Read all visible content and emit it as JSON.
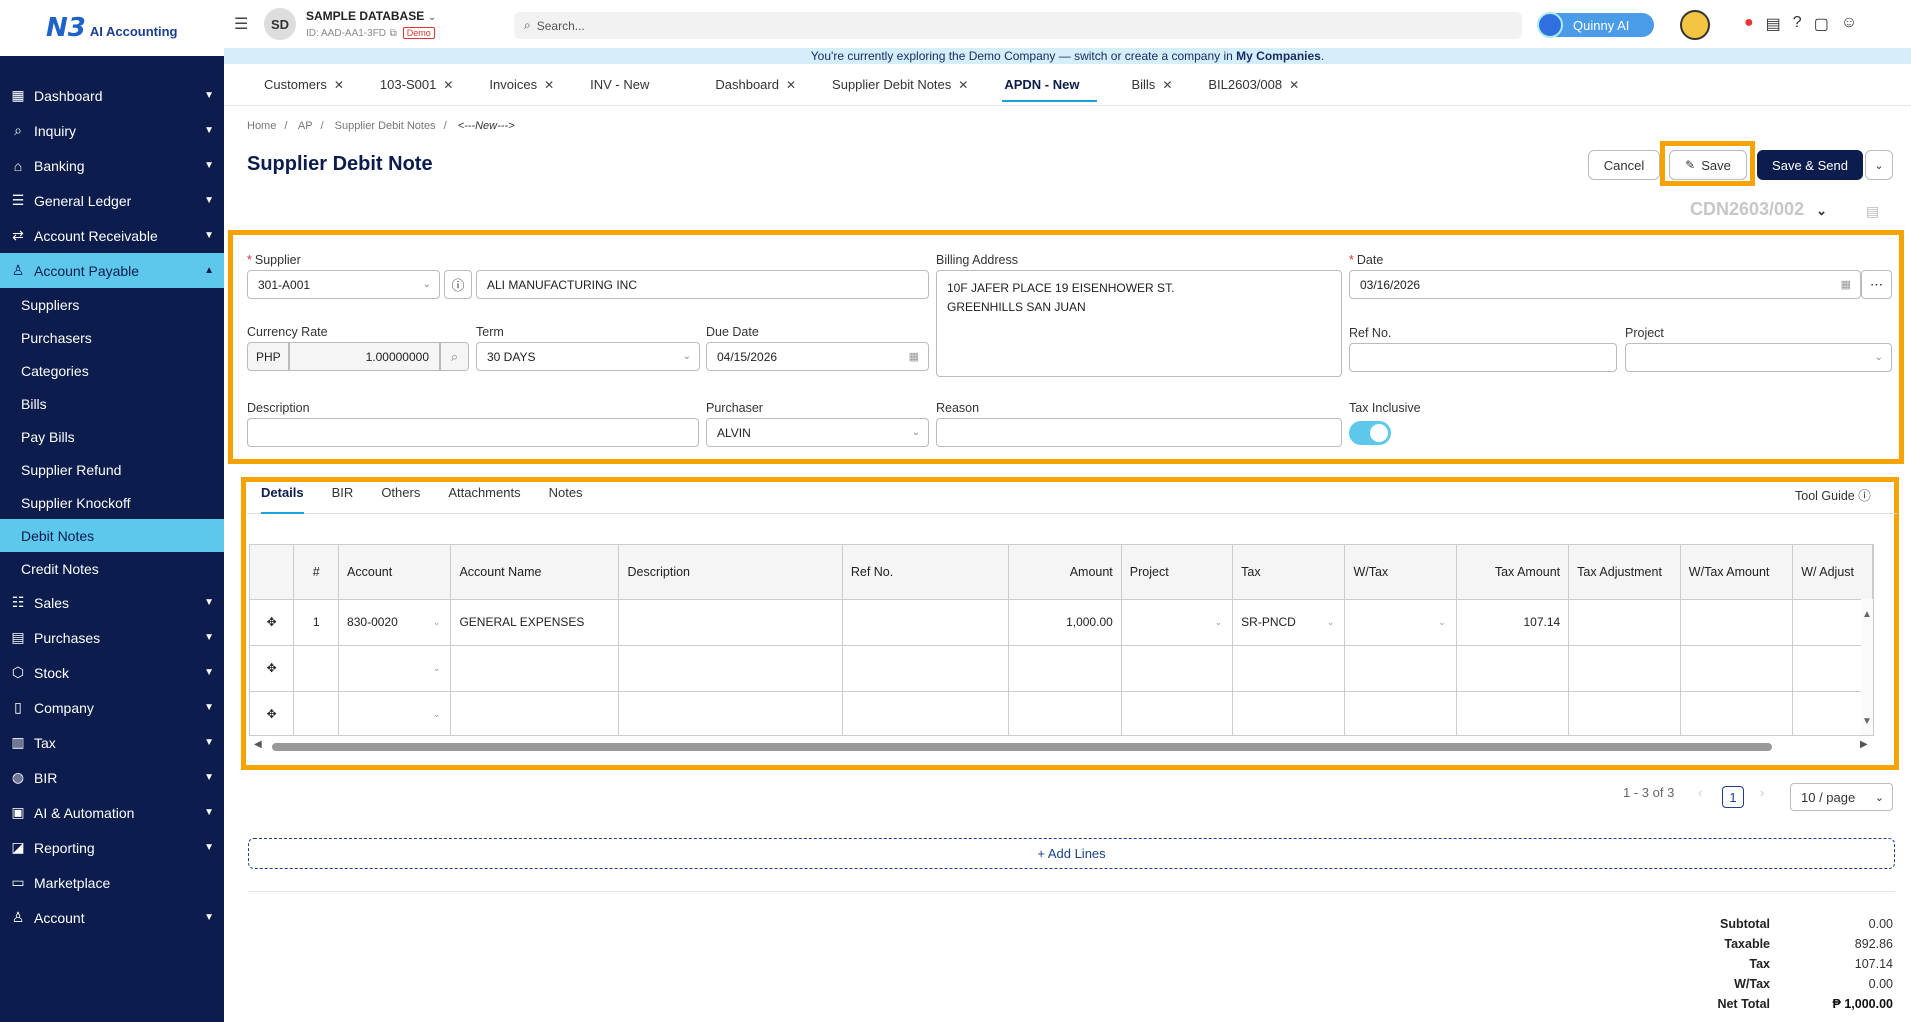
{
  "app": {
    "logo_mark": "N3",
    "logo_text": "AI Accounting"
  },
  "sidebar": {
    "items": [
      {
        "label": "Dashboard",
        "icon": "dashboard-icon",
        "chevron": "down"
      },
      {
        "label": "Inquiry",
        "icon": "inquiry-icon",
        "chevron": "down"
      },
      {
        "label": "Banking",
        "icon": "bank-icon",
        "chevron": "down"
      },
      {
        "label": "General Ledger",
        "icon": "ledger-icon",
        "chevron": "down"
      },
      {
        "label": "Account Receivable",
        "icon": "receivable-icon",
        "chevron": "down"
      },
      {
        "label": "Account Payable",
        "icon": "payable-icon",
        "chevron": "up"
      }
    ],
    "sub_items": [
      "Suppliers",
      "Purchasers",
      "Categories",
      "Bills",
      "Pay Bills",
      "Supplier Refund",
      "Supplier Knockoff",
      "Debit Notes",
      "Credit Notes"
    ],
    "items_after": [
      {
        "label": "Sales",
        "icon": "sales-icon"
      },
      {
        "label": "Purchases",
        "icon": "purchases-icon"
      },
      {
        "label": "Stock",
        "icon": "stock-icon"
      },
      {
        "label": "Company",
        "icon": "company-icon"
      },
      {
        "label": "Tax",
        "icon": "tax-icon"
      },
      {
        "label": "BIR",
        "icon": "bir-icon"
      },
      {
        "label": "AI & Automation",
        "icon": "ai-icon"
      },
      {
        "label": "Reporting",
        "icon": "reporting-icon"
      },
      {
        "label": "Marketplace",
        "icon": "marketplace-icon"
      },
      {
        "label": "Account",
        "icon": "account-icon"
      }
    ]
  },
  "topbar": {
    "avatar": "SD",
    "db_name": "SAMPLE DATABASE",
    "db_id": "ID: AAD-AA1-3FD",
    "demo": "Demo",
    "search_placeholder": "Search...",
    "quinny": "Quinny AI"
  },
  "banner": {
    "text": "You're currently exploring the Demo Company — switch or create a company in ",
    "link": "My Companies",
    "end": "."
  },
  "tabs": [
    {
      "label": "Customers",
      "close": true
    },
    {
      "label": "103-S001",
      "close": true
    },
    {
      "label": "Invoices",
      "close": true
    },
    {
      "label": "INV - New",
      "close": false
    },
    {
      "label": "Dashboard",
      "close": true
    },
    {
      "label": "Supplier Debit Notes",
      "close": true
    },
    {
      "label": "APDN - New",
      "close": false,
      "active": true
    },
    {
      "label": "Bills",
      "close": true
    },
    {
      "label": "BIL2603/008",
      "close": true
    }
  ],
  "breadcrumb": [
    "Home",
    "AP",
    "Supplier Debit Notes",
    "<---New--->"
  ],
  "page_title": "Supplier Debit Note",
  "buttons": {
    "cancel": "Cancel",
    "save": "Save",
    "save_send": "Save & Send"
  },
  "doc_no": "CDN2603/002",
  "form": {
    "supplier_label": "Supplier",
    "supplier_code": "301-A001",
    "supplier_name": "ALI MANUFACTURING INC",
    "billing_label": "Billing Address",
    "billing_line1": "10F JAFER PLACE 19 EISENHOWER ST.",
    "billing_line2": "GREENHILLS SAN JUAN",
    "date_label": "Date",
    "date": "03/16/2026",
    "currency_label": "Currency Rate",
    "currency": "PHP",
    "rate": "1.00000000",
    "term_label": "Term",
    "term": "30 DAYS",
    "due_label": "Due Date",
    "due_date": "04/15/2026",
    "refno_label": "Ref No.",
    "refno": "",
    "project_label": "Project",
    "project": "",
    "description_label": "Description",
    "description": "",
    "purchaser_label": "Purchaser",
    "purchaser": "ALVIN",
    "reason_label": "Reason",
    "reason": "",
    "tax_inclusive_label": "Tax Inclusive",
    "tax_inclusive": true
  },
  "subtabs": [
    "Details",
    "BIR",
    "Others",
    "Attachments",
    "Notes"
  ],
  "tool_guide": "Tool Guide",
  "grid": {
    "columns": [
      "",
      "#",
      "Account",
      "Account Name",
      "Description",
      "Ref No.",
      "Amount",
      "Project",
      "Tax",
      "W/Tax",
      "Tax Amount",
      "Tax Adjustment",
      "W/Tax Amount",
      "W/ Adjust"
    ],
    "rows": [
      {
        "no": "1",
        "account": "830-0020",
        "account_name": "GENERAL EXPENSES",
        "description": "",
        "ref": "",
        "amount": "1,000.00",
        "project": "",
        "tax": "SR-PNCD",
        "wtax": "",
        "tax_amount": "107.14",
        "tax_adj": "",
        "wtax_amount": ""
      },
      {
        "no": "",
        "account": "",
        "account_name": "",
        "description": "",
        "ref": "",
        "amount": "",
        "project": "",
        "tax": "",
        "wtax": "",
        "tax_amount": "",
        "tax_adj": "",
        "wtax_amount": ""
      },
      {
        "no": "",
        "account": "",
        "account_name": "",
        "description": "",
        "ref": "",
        "amount": "",
        "project": "",
        "tax": "",
        "wtax": "",
        "tax_amount": "",
        "tax_adj": "",
        "wtax_amount": ""
      }
    ]
  },
  "pagination": {
    "range": "1 - 3 of 3",
    "page": "1",
    "page_size": "10 / page"
  },
  "add_lines": "+ Add Lines",
  "totals": [
    {
      "label": "Subtotal",
      "value": "0.00"
    },
    {
      "label": "Taxable",
      "value": "892.86"
    },
    {
      "label": "Tax",
      "value": "107.14"
    },
    {
      "label": "W/Tax",
      "value": "0.00"
    },
    {
      "label": "Net Total",
      "value": "₱ 1,000.00"
    }
  ],
  "colors": {
    "sidebar_bg": "#0b1c4d",
    "accent": "#5dc8ec",
    "highlight": "#f5a300"
  }
}
